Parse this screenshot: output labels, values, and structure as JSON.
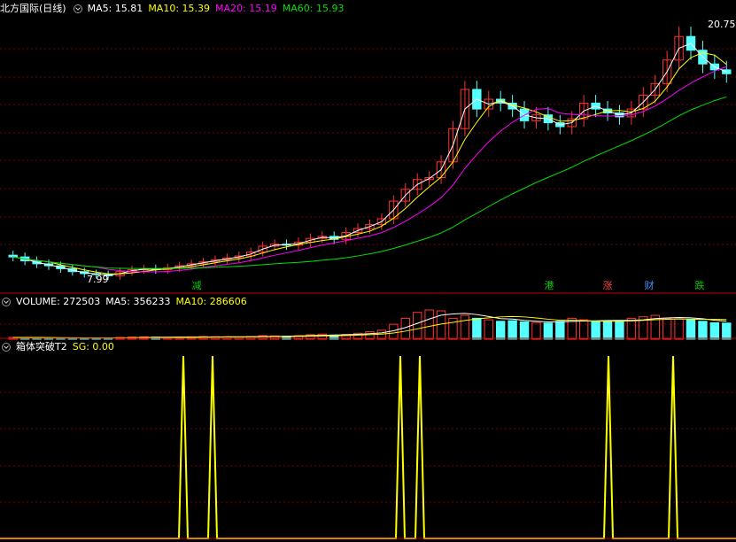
{
  "colors": {
    "up": "#ff3232",
    "down": "#54ffff",
    "ma5": "#ffffff",
    "ma10": "#ffff00",
    "ma20": "#ff00ff",
    "ma60": "#00e000",
    "signal": "#ffff00",
    "grid": "#7a0000",
    "divider": "#c00000"
  },
  "main_panel": {
    "title": "北方国际(日线)",
    "ma5": "MA5: 15.81",
    "ma10": "MA10: 15.39",
    "ma20": "MA20: 15.19",
    "ma60": "MA60: 15.93",
    "high_label": "20.75",
    "low_label": "7.99",
    "event_markers": [
      {
        "label": "减",
        "color": "#00d000"
      },
      {
        "label": "港",
        "color": "#00d000"
      },
      {
        "label": "涨",
        "color": "#ff4040"
      },
      {
        "label": "财",
        "color": "#4090ff"
      },
      {
        "label": "跌",
        "color": "#00d000"
      }
    ]
  },
  "volume_panel": {
    "title": "VOLUME: 272503",
    "ma5": "MA5: 356233",
    "ma10": "MA10: 286606"
  },
  "indicator_panel": {
    "title": "箱体突破T2",
    "sg": "SG: 0.00"
  },
  "chart_data": [
    {
      "type": "candlestick",
      "name": "price",
      "high": 20.75,
      "low": 7.99,
      "close_series": [
        8.95,
        8.75,
        8.6,
        8.5,
        8.35,
        8.2,
        8.1,
        8.05,
        7.99,
        8.2,
        8.3,
        8.35,
        8.3,
        8.4,
        8.5,
        8.6,
        8.7,
        8.8,
        8.9,
        9.0,
        9.2,
        9.5,
        9.6,
        9.55,
        9.7,
        9.9,
        10.0,
        9.85,
        10.2,
        10.4,
        10.6,
        10.9,
        11.8,
        12.4,
        12.9,
        13.0,
        13.8,
        15.5,
        17.5,
        16.5,
        17.0,
        16.8,
        16.5,
        15.9,
        16.2,
        15.8,
        15.6,
        16.0,
        16.8,
        16.5,
        16.3,
        16.1,
        16.5,
        17.2,
        17.8,
        19.0,
        20.2,
        19.5,
        18.8,
        18.5,
        18.3
      ],
      "ma_names": [
        "MA5",
        "MA10",
        "MA20",
        "MA60"
      ]
    },
    {
      "type": "bar",
      "name": "volume",
      "values": [
        60,
        55,
        50,
        45,
        40,
        38,
        35,
        35,
        40,
        60,
        70,
        80,
        70,
        60,
        65,
        80,
        90,
        85,
        80,
        70,
        90,
        120,
        110,
        100,
        120,
        150,
        170,
        140,
        160,
        200,
        250,
        300,
        500,
        700,
        900,
        980,
        950,
        700,
        800,
        700,
        650,
        600,
        620,
        580,
        560,
        540,
        600,
        700,
        650,
        600,
        580,
        620,
        700,
        750,
        800,
        700,
        680,
        650,
        600,
        550,
        540
      ]
    },
    {
      "type": "line",
      "name": "箱体突破T2 SG",
      "spikes": [
        0,
        1,
        0,
        1,
        0,
        0,
        0,
        1,
        1,
        0,
        0,
        0,
        1,
        0,
        0,
        1,
        0
      ]
    }
  ]
}
